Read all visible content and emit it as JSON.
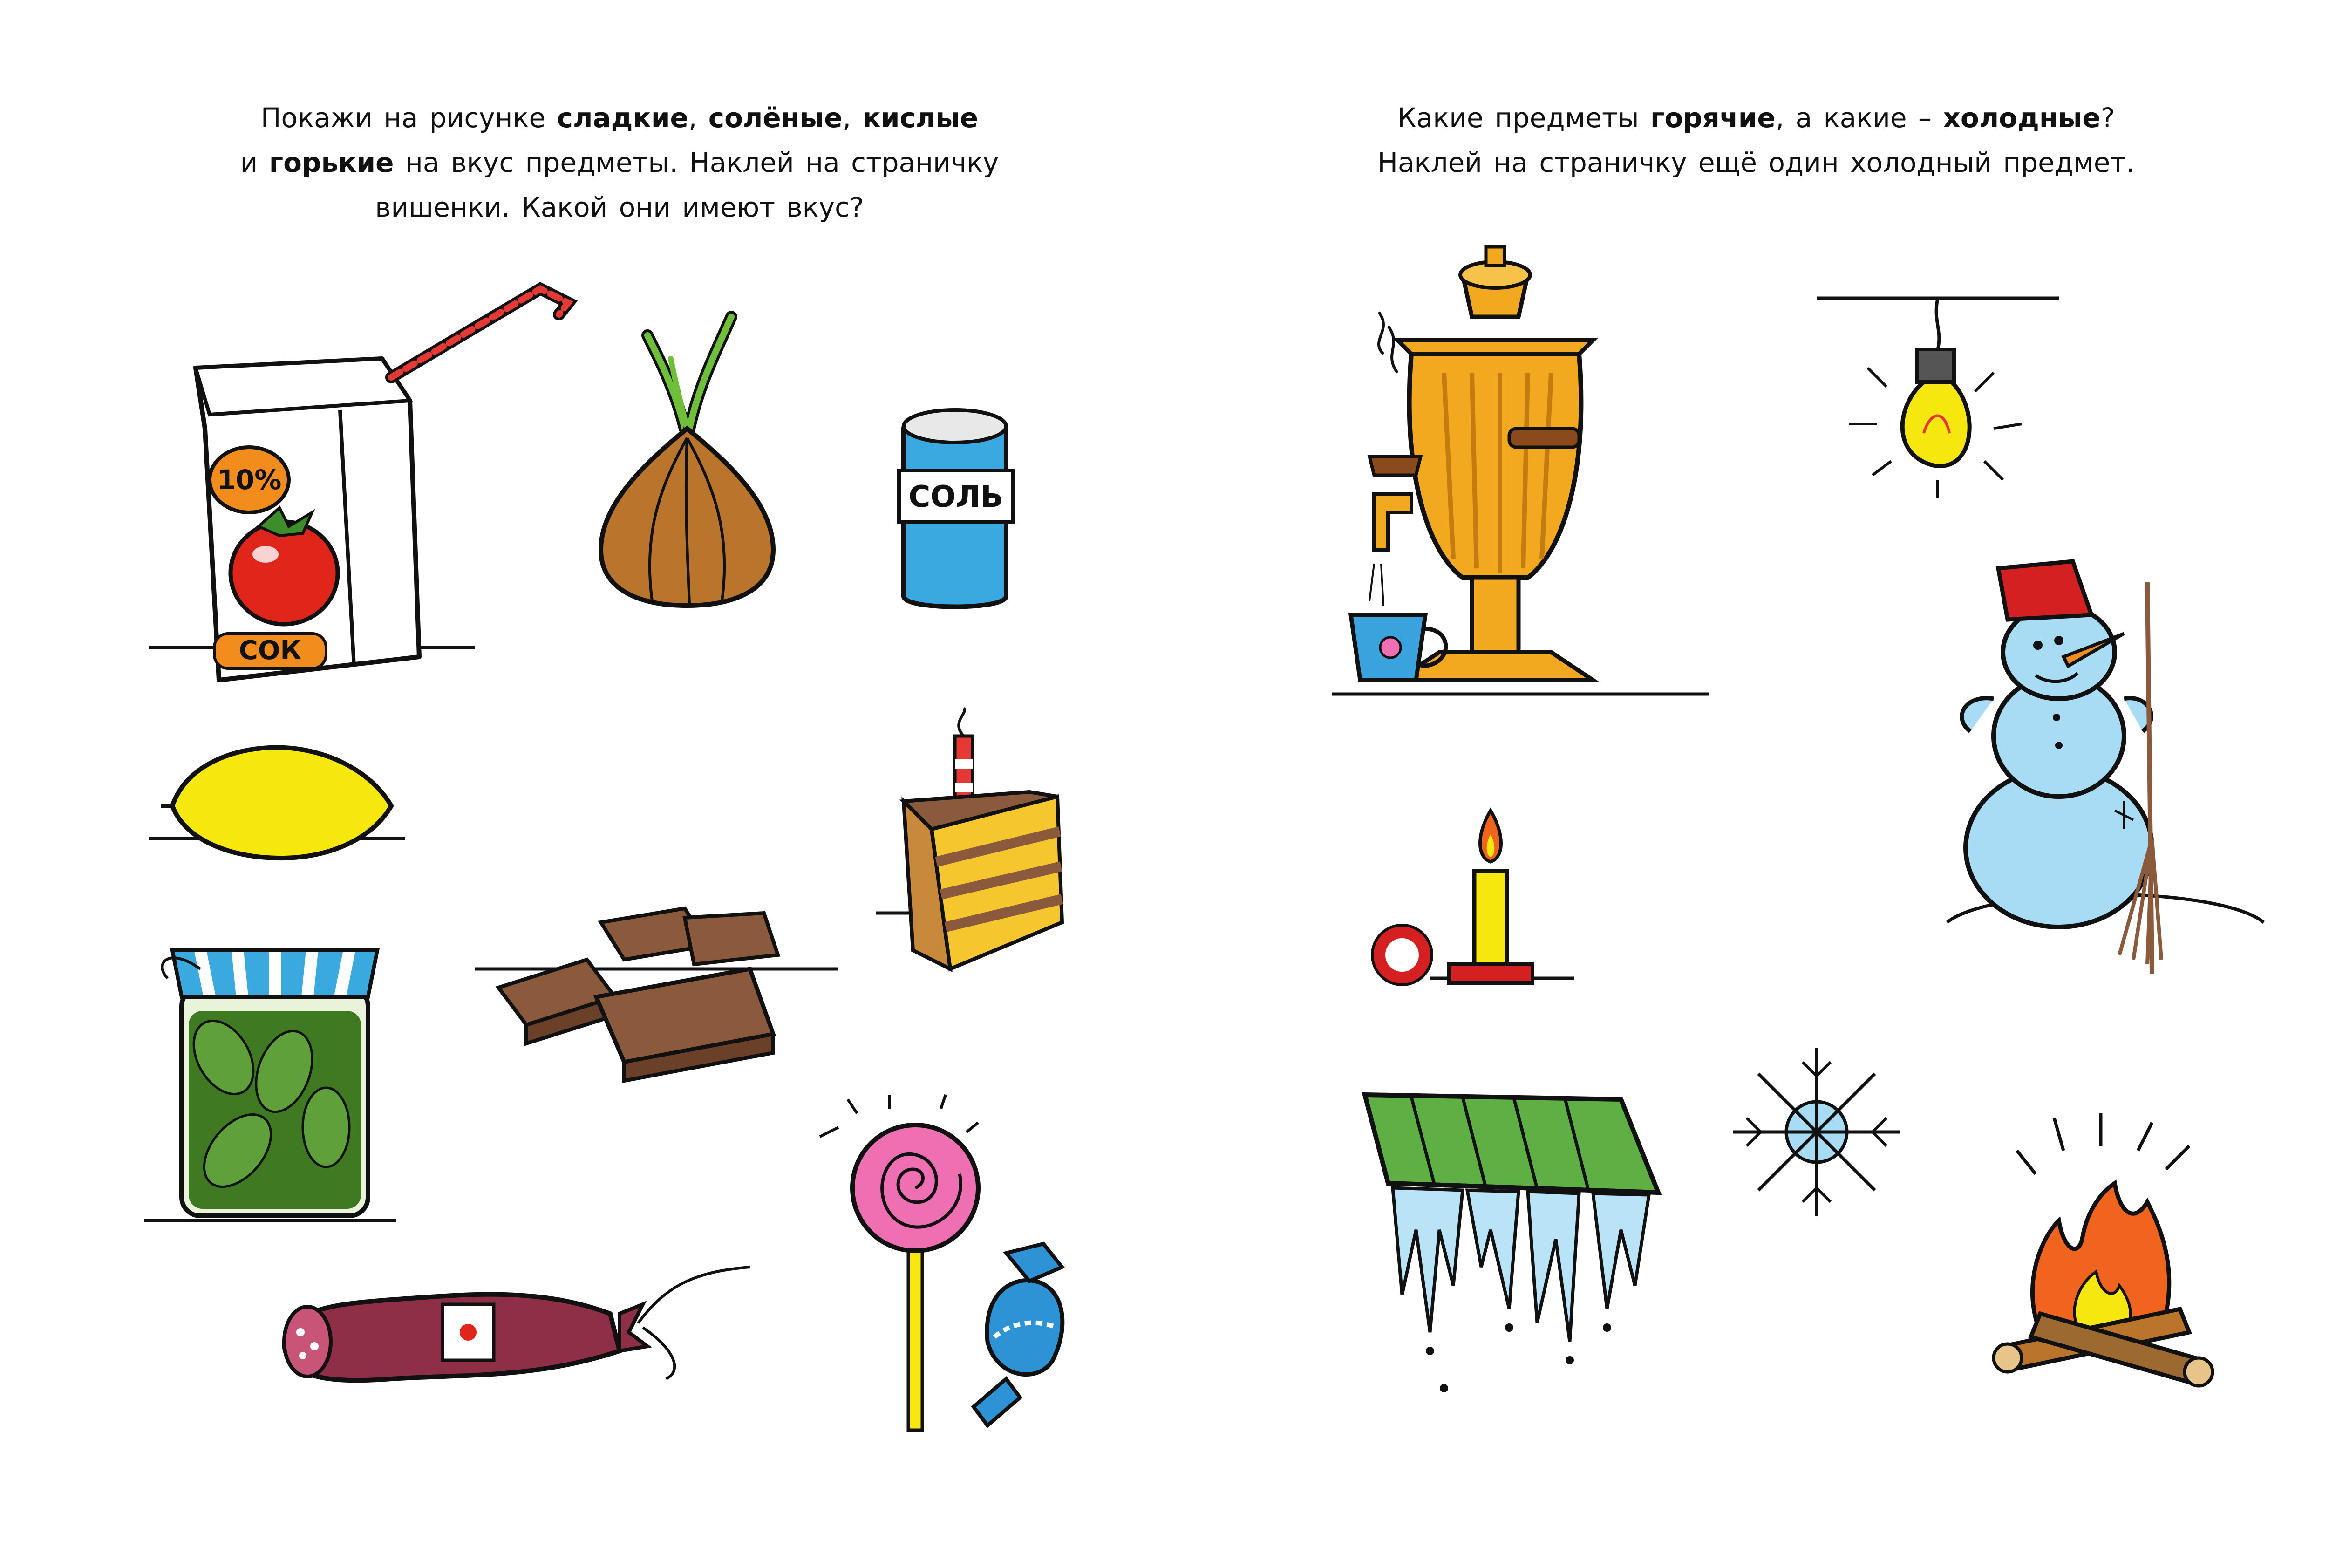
{
  "left_page": {
    "instruction": {
      "l1_a": "Покажи на рисунке ",
      "l1_sweet": "сладкие",
      "l1_sep1": ", ",
      "l1_salty": "солёные",
      "l1_sep2": ", ",
      "l1_sour": "кислые",
      "l2_and": "и ",
      "l2_bitter": "горькие",
      "l2_rest": " на вкус предметы. Наклей на страничку",
      "l3": "вишенки. Какой они имеют вкус?"
    },
    "items": {
      "juice_box": {
        "badge": "10%",
        "label": "СОК"
      },
      "salt_shaker": {
        "label": "СОЛЬ"
      }
    }
  },
  "right_page": {
    "instruction": {
      "l1_a": "Какие предметы ",
      "l1_hot": "горячие",
      "l1_b": ", а какие – ",
      "l1_cold": "холодные",
      "l1_c": "?",
      "l2": "Наклей на страничку ещё один холодный предмет."
    }
  },
  "colors": {
    "outline": "#111111",
    "tomato_red": "#e0261b",
    "juice_orange": "#f28c1c",
    "onion_brown": "#b8752b",
    "salt_blue": "#3aa9e0",
    "lemon_yellow": "#f6e70e",
    "cake_yellow": "#f5c62e",
    "chocolate": "#8b5a3c",
    "pickle_green": "#3f7a22",
    "sausage": "#8e2f47",
    "lollipop_pink": "#ee6fb2",
    "candy_blue": "#2d93d4",
    "samovar_gold": "#f2a81f",
    "cup_blue": "#3aa2dc",
    "snowman_blue": "#a8dcf5",
    "bucket_red": "#d42020",
    "roof_green": "#5fb044",
    "icicle_blue": "#b9e3f6",
    "fire_orange": "#f0641e"
  }
}
